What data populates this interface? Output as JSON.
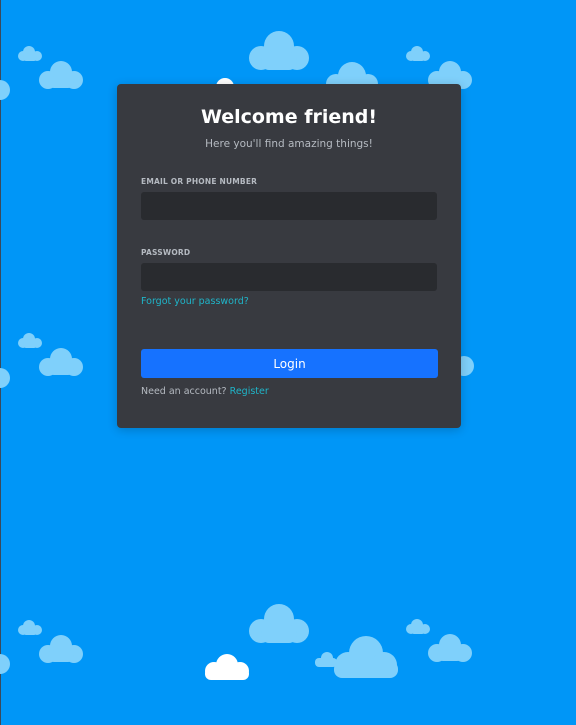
{
  "login": {
    "title": "Welcome friend!",
    "subtitle": "Here you'll find amazing things!",
    "email_label": "EMAIL OR PHONE NUMBER",
    "email_value": "",
    "password_label": "PASSWORD",
    "password_value": "",
    "forgot_link": "Forgot your password?",
    "login_button": "Login",
    "need_account": "Need an account?",
    "register_link": "Register"
  },
  "colors": {
    "background": "#0096f7",
    "card": "#383a40",
    "input": "#292b2f",
    "button": "#1672ff",
    "link": "#1fb5c9",
    "cloud_light": "#7fd0fb",
    "cloud_white": "#ffffff"
  }
}
